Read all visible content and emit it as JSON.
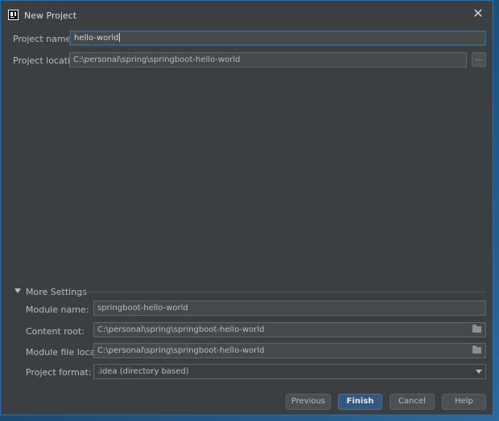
{
  "window": {
    "title": "New Project"
  },
  "form": {
    "project_name": {
      "label": "Project name:",
      "value": "hello-world"
    },
    "project_location": {
      "label": "Project location:",
      "value": "C:\\personal\\spring\\springboot-hello-world",
      "browse_label": "..."
    }
  },
  "more_settings": {
    "title": "More Settings",
    "module_name": {
      "label": "Module name:",
      "value": "springboot-hello-world"
    },
    "content_root": {
      "label": "Content root:",
      "value": "C:\\personal\\spring\\springboot-hello-world"
    },
    "module_file_location": {
      "label": "Module file location:",
      "value": "C:\\personal\\spring\\springboot-hello-world"
    },
    "project_format": {
      "label": "Project format:",
      "value": ".idea (directory based)"
    }
  },
  "buttons": {
    "previous": "Previous",
    "finish": "Finish",
    "cancel": "Cancel",
    "help": "Help"
  },
  "colors": {
    "dialog_bg": "#3c3f41",
    "field_bg": "#45494a",
    "focus_border": "#3d6185",
    "primary_button": "#365880"
  }
}
